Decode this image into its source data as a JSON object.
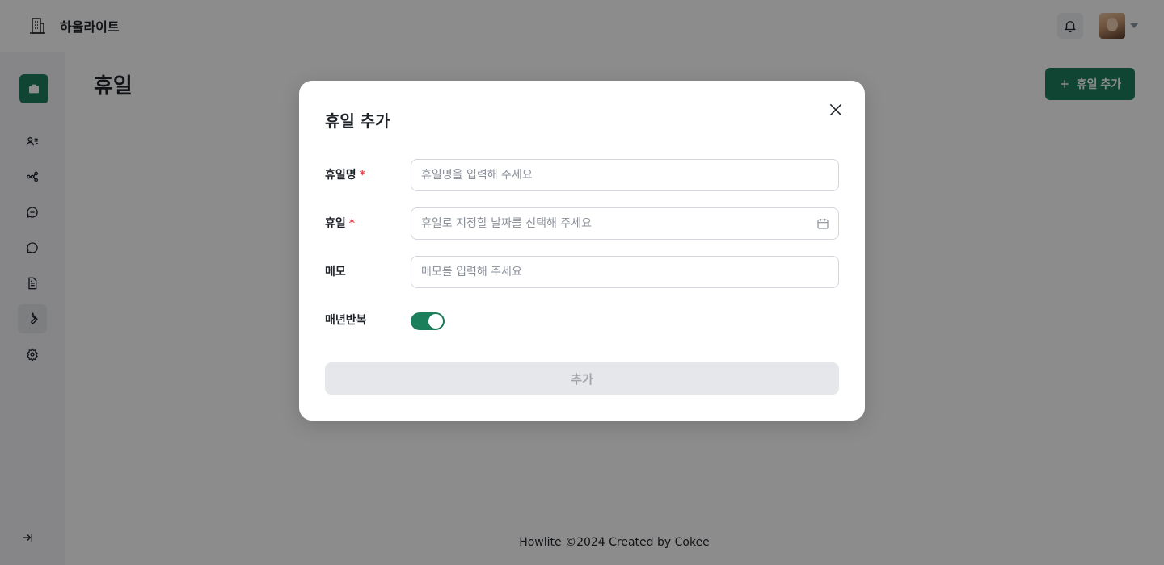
{
  "app": {
    "brand_name": "하울라이트",
    "brand_icon": "building-icon"
  },
  "header": {
    "notification_icon": "bell-icon",
    "avatar_icon": "user-avatar",
    "menu_icon": "caret-down-icon"
  },
  "sidebar": {
    "logo_icon": "briefcase-icon",
    "items": [
      {
        "icon": "member-list-icon",
        "active": false
      },
      {
        "icon": "organization-icon",
        "active": false
      },
      {
        "icon": "chat-icon",
        "active": false
      },
      {
        "icon": "chat-dots-icon",
        "active": false
      },
      {
        "icon": "document-icon",
        "active": false
      },
      {
        "icon": "wrench-icon",
        "active": true
      },
      {
        "icon": "settings-icon",
        "active": false
      }
    ],
    "collapse_icon": "expand-right-icon"
  },
  "page": {
    "title": "휴일",
    "add_button_label": "휴일 추가",
    "add_button_icon": "plus-icon"
  },
  "modal": {
    "title": "휴일 추가",
    "close_icon": "close-icon",
    "fields": {
      "name": {
        "label": "휴일명",
        "required_mark": "*",
        "placeholder": "휴일명을 입력해 주세요",
        "value": ""
      },
      "date": {
        "label": "휴일",
        "required_mark": "*",
        "placeholder": "휴일로 지정할 날짜를 선택해 주세요",
        "value": "",
        "icon": "calendar-icon"
      },
      "memo": {
        "label": "메모",
        "placeholder": "메모를 입력해 주세요",
        "value": ""
      },
      "repeat": {
        "label": "매년반복",
        "checked": true
      }
    },
    "submit_label": "추가",
    "submit_disabled": true
  },
  "footer": {
    "text": "Howlite ©2024 Created by Cokee"
  },
  "colors": {
    "primary": "#1c7f5c",
    "required": "#e5484d",
    "disabled_bg": "#e5e7ea",
    "overlay": "rgba(0,0,0,0.45)"
  }
}
